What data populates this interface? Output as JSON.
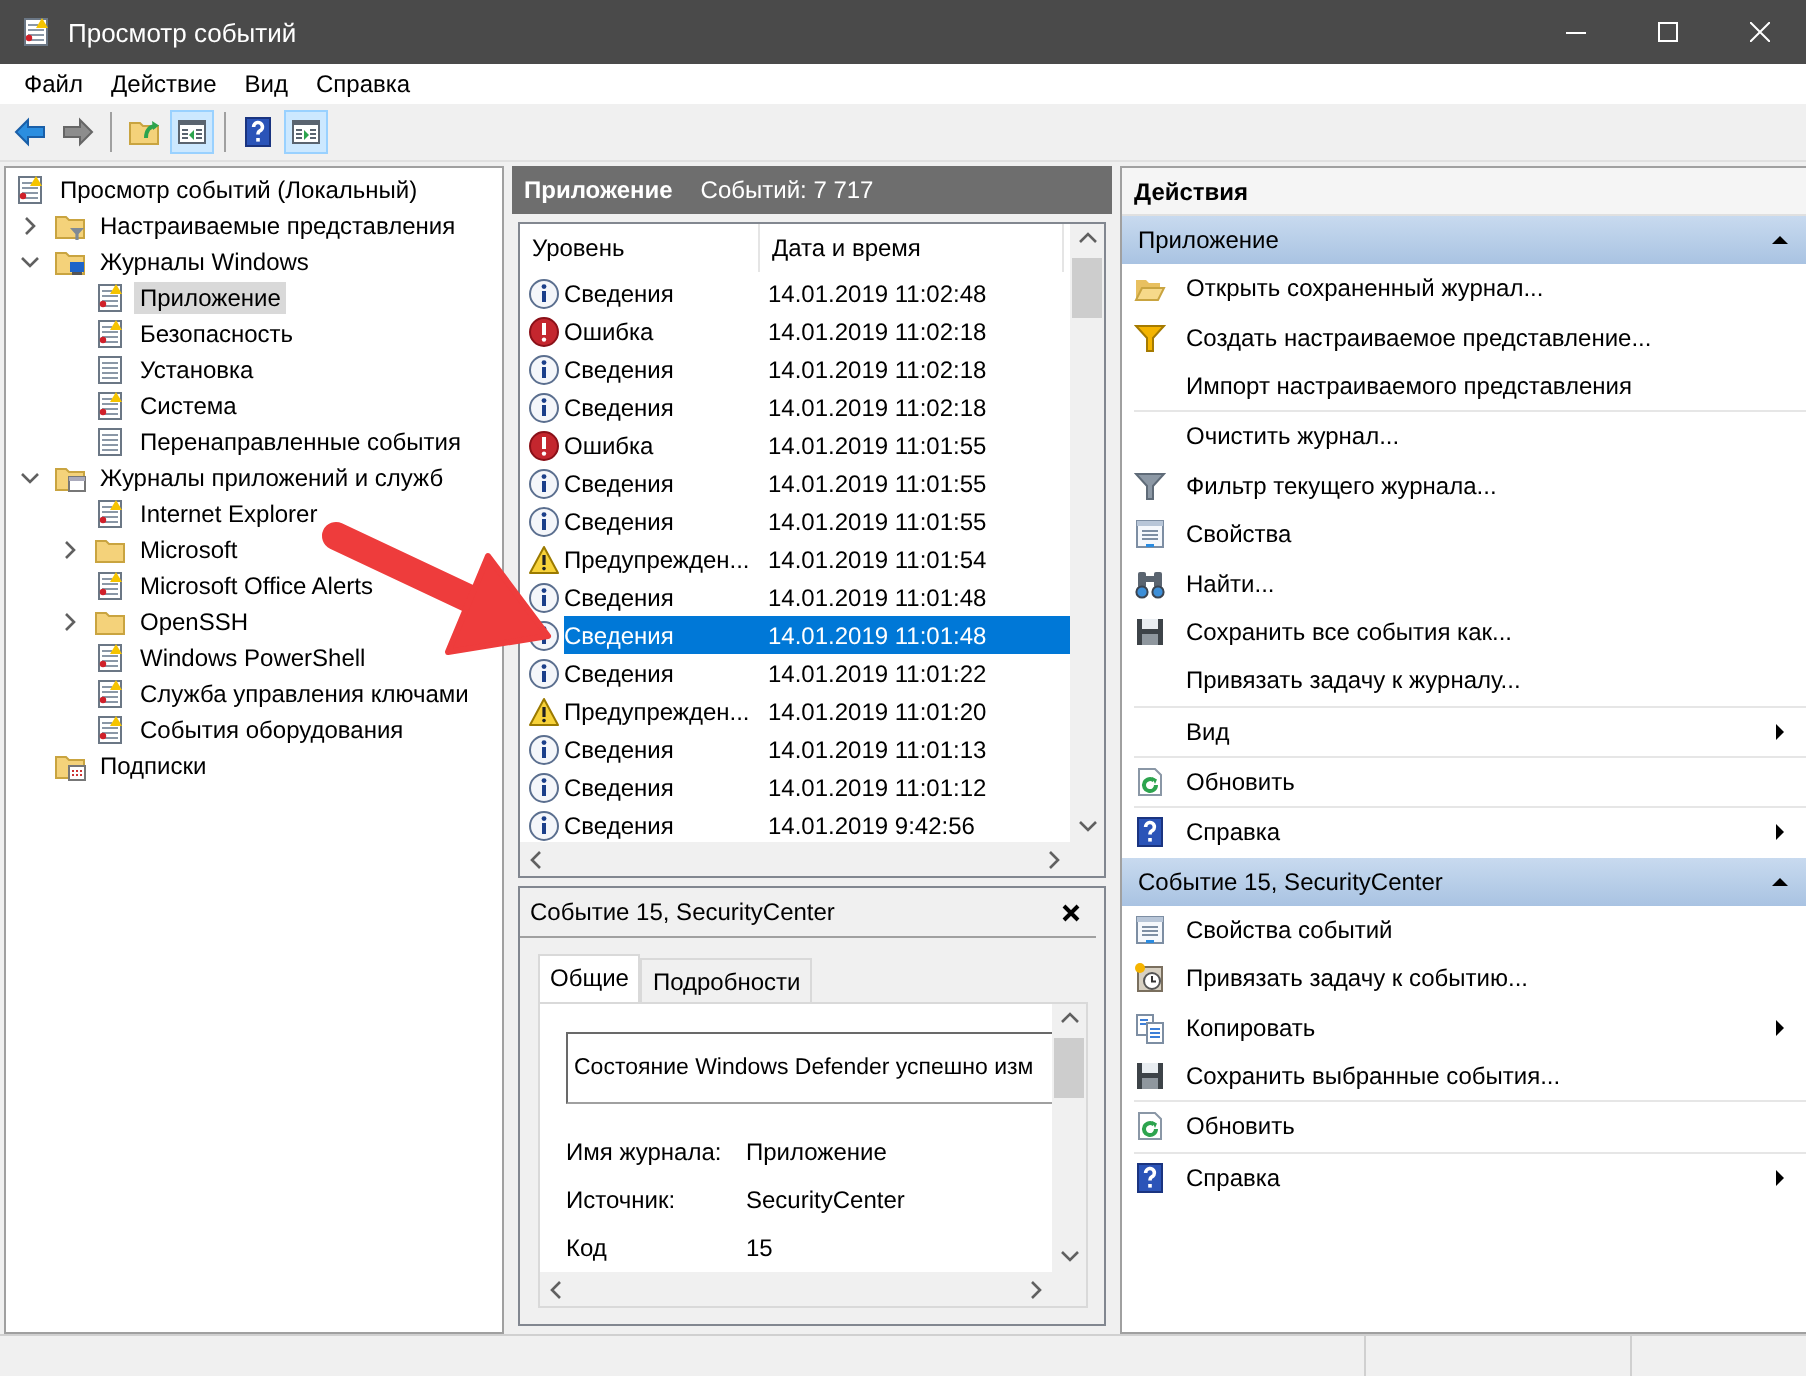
{
  "window": {
    "title": "Просмотр событий"
  },
  "menu": [
    "Файл",
    "Действие",
    "Вид",
    "Справка"
  ],
  "toolbar": [
    {
      "kind": "back",
      "pressed": false
    },
    {
      "kind": "forward",
      "pressed": false
    },
    {
      "kind": "separator"
    },
    {
      "kind": "folder-up",
      "pressed": false
    },
    {
      "kind": "pane-left",
      "pressed": true
    },
    {
      "kind": "separator"
    },
    {
      "kind": "help",
      "pressed": false
    },
    {
      "kind": "pane-right",
      "pressed": true
    }
  ],
  "tree": [
    {
      "label": "Просмотр событий (Локальный)",
      "kind": "log",
      "selected": false,
      "children": [
        {
          "label": "Настраиваемые представления",
          "kind": "folder-filter",
          "expanded": false,
          "selected": false
        },
        {
          "label": "Журналы Windows",
          "kind": "folder-windows",
          "expanded": true,
          "selected": false,
          "children": [
            {
              "label": "Приложение",
              "kind": "log",
              "selected": true
            },
            {
              "label": "Безопасность",
              "kind": "log",
              "selected": false
            },
            {
              "label": "Установка",
              "kind": "log-plain",
              "selected": false
            },
            {
              "label": "Система",
              "kind": "log",
              "selected": false
            },
            {
              "label": "Перенаправленные события",
              "kind": "log-plain",
              "selected": false
            }
          ]
        },
        {
          "label": "Журналы приложений и служб",
          "kind": "folder-app",
          "expanded": true,
          "selected": false,
          "children": [
            {
              "label": "Internet Explorer",
              "kind": "log",
              "selected": false
            },
            {
              "label": "Microsoft",
              "kind": "folder",
              "expanded": false,
              "selected": false
            },
            {
              "label": "Microsoft Office Alerts",
              "kind": "log",
              "selected": false
            },
            {
              "label": "OpenSSH",
              "kind": "folder",
              "expanded": false,
              "selected": false
            },
            {
              "label": "Windows PowerShell",
              "kind": "log",
              "selected": false
            },
            {
              "label": "Служба управления ключами",
              "kind": "log",
              "selected": false
            },
            {
              "label": "События оборудования",
              "kind": "log",
              "selected": false
            }
          ]
        },
        {
          "label": "Подписки",
          "kind": "subscriptions",
          "selected": false
        }
      ]
    }
  ],
  "events": {
    "title": "Приложение",
    "count": "Событий: 7 717",
    "columns": [
      "Уровень",
      "Дата и время"
    ],
    "rows": [
      {
        "kind": "info",
        "text": "Сведения",
        "datetime": "14.01.2019 11:02:48",
        "selected": false
      },
      {
        "kind": "error",
        "text": "Ошибка",
        "datetime": "14.01.2019 11:02:18",
        "selected": false
      },
      {
        "kind": "info",
        "text": "Сведения",
        "datetime": "14.01.2019 11:02:18",
        "selected": false
      },
      {
        "kind": "info",
        "text": "Сведения",
        "datetime": "14.01.2019 11:02:18",
        "selected": false
      },
      {
        "kind": "error",
        "text": "Ошибка",
        "datetime": "14.01.2019 11:01:55",
        "selected": false
      },
      {
        "kind": "info",
        "text": "Сведения",
        "datetime": "14.01.2019 11:01:55",
        "selected": false
      },
      {
        "kind": "info",
        "text": "Сведения",
        "datetime": "14.01.2019 11:01:55",
        "selected": false
      },
      {
        "kind": "warning",
        "text": "Предупрежден...",
        "datetime": "14.01.2019 11:01:54",
        "selected": false
      },
      {
        "kind": "info",
        "text": "Сведения",
        "datetime": "14.01.2019 11:01:48",
        "selected": false
      },
      {
        "kind": "info",
        "text": "Сведения",
        "datetime": "14.01.2019 11:01:48",
        "selected": true
      },
      {
        "kind": "info",
        "text": "Сведения",
        "datetime": "14.01.2019 11:01:22",
        "selected": false
      },
      {
        "kind": "warning",
        "text": "Предупрежден...",
        "datetime": "14.01.2019 11:01:20",
        "selected": false
      },
      {
        "kind": "info",
        "text": "Сведения",
        "datetime": "14.01.2019 11:01:13",
        "selected": false
      },
      {
        "kind": "info",
        "text": "Сведения",
        "datetime": "14.01.2019 11:01:12",
        "selected": false
      },
      {
        "kind": "info",
        "text": "Сведения",
        "datetime": "14.01.2019 9:42:56",
        "selected": false
      }
    ]
  },
  "detail": {
    "title": "Событие 15, SecurityCenter",
    "tabs": [
      {
        "label": "Общие",
        "selected": true
      },
      {
        "label": "Подробности",
        "selected": false
      }
    ],
    "message": "Состояние Windows Defender успешно изм",
    "fields": [
      {
        "label": "Имя журнала:",
        "value": "Приложение"
      },
      {
        "label": "Источник:",
        "value": "SecurityCenter"
      },
      {
        "label": "Код",
        "value": "15"
      }
    ]
  },
  "actions": {
    "title": "Действия",
    "sections": [
      {
        "title": "Приложение",
        "expanded": true,
        "groups": [
          [
            {
              "label": "Открыть сохраненный журнал...",
              "kind": "open",
              "submenu": false
            },
            {
              "label": "Создать настраиваемое представление...",
              "kind": "filter-yellow",
              "submenu": false
            },
            {
              "label": "Импорт настраиваемого представления",
              "kind": "plain",
              "submenu": false
            }
          ],
          [
            {
              "label": "Очистить журнал...",
              "kind": "plain",
              "submenu": false
            },
            {
              "label": "Фильтр текущего журнала...",
              "kind": "filter",
              "submenu": false
            },
            {
              "label": "Свойства",
              "kind": "properties",
              "submenu": false
            },
            {
              "label": "Найти...",
              "kind": "binoculars",
              "submenu": false
            },
            {
              "label": "Сохранить все события как...",
              "kind": "save",
              "submenu": false
            },
            {
              "label": "Привязать задачу к журналу...",
              "kind": "plain",
              "submenu": false
            }
          ],
          [
            {
              "label": "Вид",
              "kind": "plain",
              "submenu": true
            }
          ],
          [
            {
              "label": "Обновить",
              "kind": "refresh",
              "submenu": false
            }
          ],
          [
            {
              "label": "Справка",
              "kind": "help",
              "submenu": true
            }
          ]
        ]
      },
      {
        "title": "Событие 15, SecurityCenter",
        "expanded": true,
        "groups": [
          [
            {
              "label": "Свойства событий",
              "kind": "properties",
              "submenu": false
            },
            {
              "label": "Привязать задачу к событию...",
              "kind": "task",
              "submenu": false
            },
            {
              "label": "Копировать",
              "kind": "copy",
              "submenu": true
            },
            {
              "label": "Сохранить выбранные события...",
              "kind": "save",
              "submenu": false
            }
          ],
          [
            {
              "label": "Обновить",
              "kind": "refresh",
              "submenu": false
            }
          ],
          [
            {
              "label": "Справка",
              "kind": "help",
              "submenu": true
            }
          ]
        ]
      }
    ]
  },
  "annotation": {
    "kind": "arrow"
  }
}
